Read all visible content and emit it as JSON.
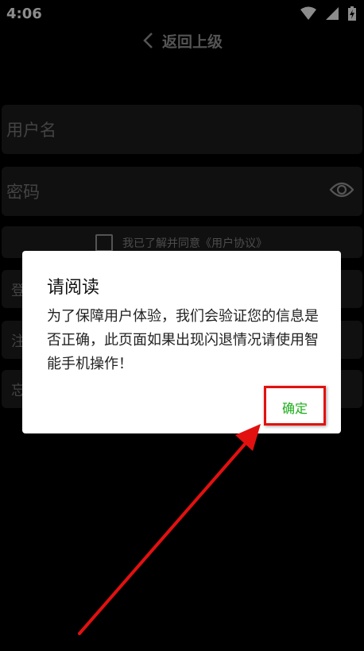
{
  "status_bar": {
    "time": "4:06",
    "icons": [
      "wifi-icon",
      "signal-icon",
      "battery-charging-icon"
    ]
  },
  "nav": {
    "back_label": "返回上级"
  },
  "form": {
    "username_placeholder": "用户名",
    "password_placeholder": "密码",
    "agree_label": "我已了解并同意《用户协议》",
    "login_label": "登",
    "register_label": "注",
    "forgot_label": "忘"
  },
  "dialog": {
    "title": "请阅读",
    "message": "为了保障用户体验，我们会验证您的信息是否正确，此页面如果出现闪退情况请使用智能手机操作！",
    "confirm_label": "确定"
  },
  "colors": {
    "confirm_text": "#1aad19",
    "highlight_border": "#e31010",
    "arrow": "#e31010"
  }
}
